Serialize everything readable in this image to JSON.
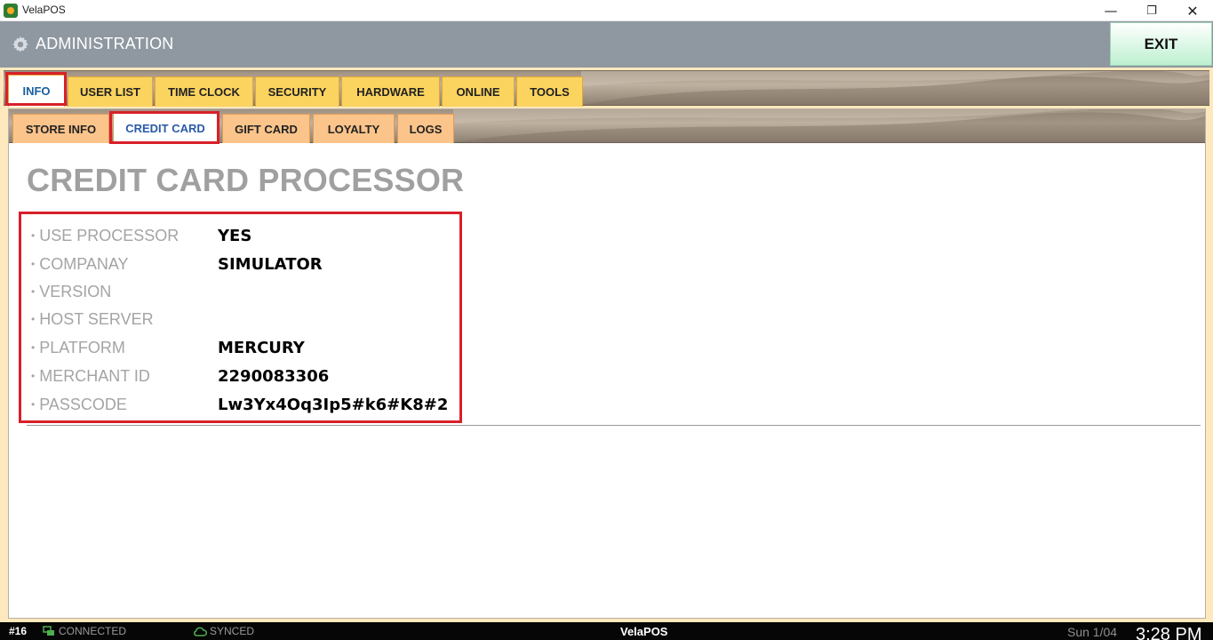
{
  "window": {
    "title": "VelaPOS",
    "minimize": "—",
    "maximize": "❐",
    "close": "✕"
  },
  "header": {
    "title": "ADMINISTRATION",
    "exit_label": "EXIT",
    "icon": "gear-icon"
  },
  "tabs": [
    {
      "label": "INFO",
      "active": true
    },
    {
      "label": "USER LIST"
    },
    {
      "label": "TIME CLOCK"
    },
    {
      "label": "SECURITY"
    },
    {
      "label": "HARDWARE"
    },
    {
      "label": "ONLINE"
    },
    {
      "label": "TOOLS"
    }
  ],
  "subtabs": [
    {
      "label": "STORE INFO"
    },
    {
      "label": "CREDIT CARD",
      "active": true
    },
    {
      "label": "GIFT CARD"
    },
    {
      "label": "LOYALTY"
    },
    {
      "label": "LOGS"
    }
  ],
  "content": {
    "title": "CREDIT CARD PROCESSOR",
    "bullet": "•",
    "rows": [
      {
        "label": "USE PROCESSOR",
        "value": "YES"
      },
      {
        "label": "COMPANAY",
        "value": "SIMULATOR"
      },
      {
        "label": "VERSION",
        "value": ""
      },
      {
        "label": "HOST SERVER",
        "value": ""
      },
      {
        "label": "PLATFORM",
        "value": "MERCURY"
      },
      {
        "label": "MERCHANT ID",
        "value": "2290083306"
      },
      {
        "label": "PASSCODE",
        "value": "Lw3Yx4Oq3Ip5#k6#K8#2"
      }
    ]
  },
  "statusbar": {
    "station": "#16",
    "connection": "CONNECTED",
    "sync": "SYNCED",
    "brand": "VelaPOS",
    "date": "Sun 1/04",
    "time": "3:28 PM"
  },
  "colors": {
    "header_bg": "#8f98a1",
    "tab_bg": "#fbd35f",
    "subtab_bg": "#fbc48a",
    "highlight": "#d8202a",
    "exit_bg": "#bdf0d0"
  }
}
